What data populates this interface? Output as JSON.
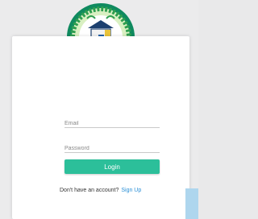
{
  "form": {
    "email_placeholder": "Email",
    "password_placeholder": "Password",
    "login_label": "Login",
    "signup_prompt": "Don't have an account?",
    "signup_link": "Sign Up"
  },
  "colors": {
    "accent": "#2cbf9a",
    "link": "#2a8fd6",
    "logo_ring": "#1a9a6b",
    "corner_highlight": "#aed6ee"
  },
  "icons": {
    "logo": "school-emblem-icon"
  }
}
